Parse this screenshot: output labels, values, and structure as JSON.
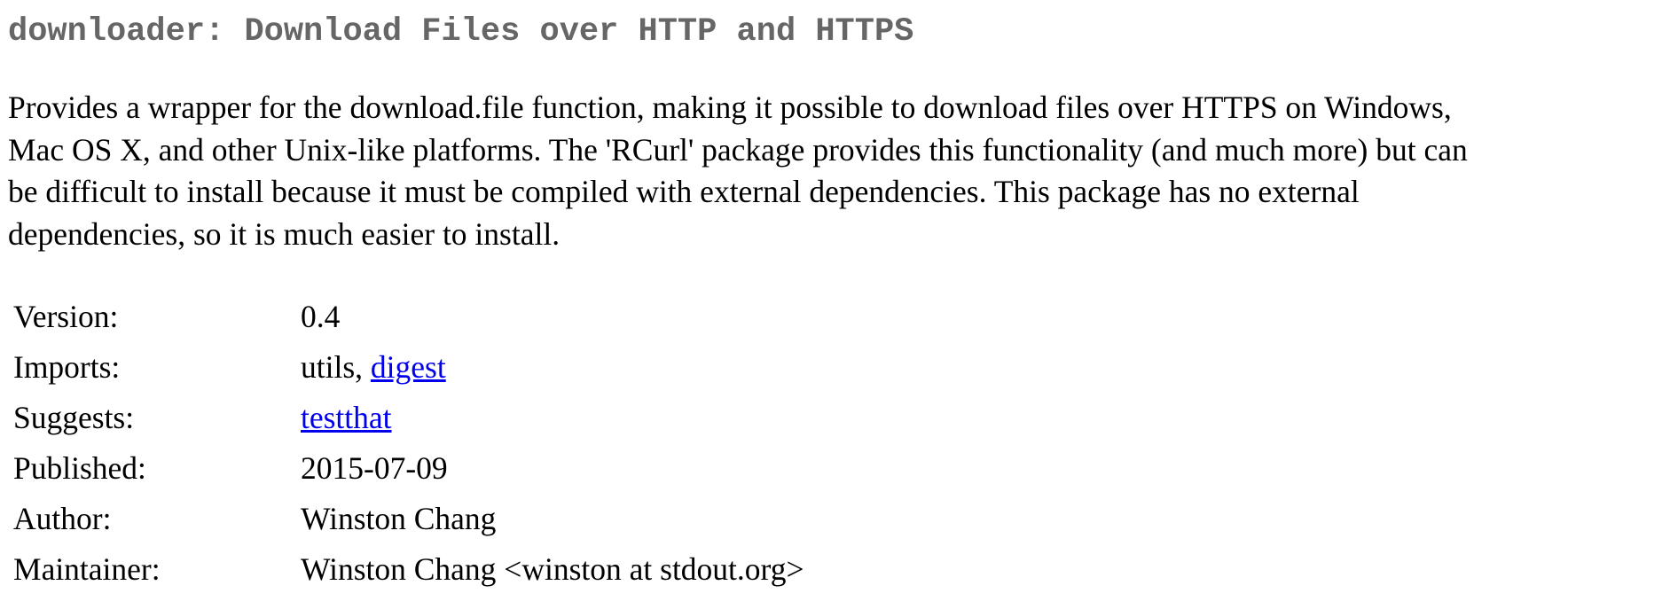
{
  "header": {
    "title": "downloader: Download Files over HTTP and HTTPS"
  },
  "description": {
    "lines": [
      "Provides a wrapper for the download.file function, making it possible to download files over HTTPS on Windows,",
      "Mac OS X, and other Unix-like platforms. The 'RCurl' package provides this functionality (and much more) but can",
      "be difficult to install because it must be compiled with external dependencies. This package has no external",
      "dependencies, so it is much easier to install."
    ]
  },
  "details": {
    "version": {
      "label": "Version:",
      "value": "0.4"
    },
    "imports": {
      "label": "Imports:",
      "plain": "utils, ",
      "link": "digest"
    },
    "suggests": {
      "label": "Suggests:",
      "link": "testthat"
    },
    "published": {
      "label": "Published:",
      "value": "2015-07-09"
    },
    "author": {
      "label": "Author:",
      "value": "Winston Chang"
    },
    "maintainer": {
      "label": "Maintainer:",
      "value": "Winston Chang <winston at stdout.org>"
    }
  },
  "colors": {
    "title": "#666666",
    "link": "#0000ee",
    "text": "#000000",
    "background": "#ffffff"
  }
}
